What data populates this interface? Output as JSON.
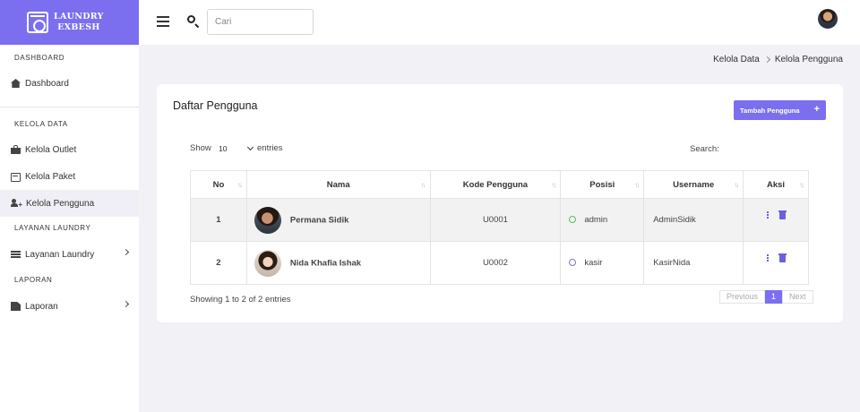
{
  "brand": {
    "line1": "LAUNDRY",
    "line2": "EXBESH"
  },
  "sidebar": {
    "sections": [
      "DASHBOARD",
      "KELOLA DATA",
      "LAYANAN LAUNDRY",
      "LAPORAN"
    ],
    "items": [
      {
        "label": "Dashboard",
        "icon": "home-icon"
      },
      {
        "label": "Kelola Outlet",
        "icon": "shopping-bag-icon"
      },
      {
        "label": "Kelola Paket",
        "icon": "card-icon"
      },
      {
        "label": "Kelola Pengguna",
        "icon": "user-plus-icon",
        "active": true
      },
      {
        "label": "Layanan Laundry",
        "icon": "list-icon"
      },
      {
        "label": "Laporan",
        "icon": "file-icon"
      }
    ]
  },
  "topbar": {
    "search_placeholder": "Cari"
  },
  "breadcrumb": [
    "Kelola Data",
    "Kelola Pengguna"
  ],
  "card": {
    "title": "Daftar Pengguna",
    "add_button": "Tambah Pengguna",
    "show_label": "Show",
    "length_value": "10",
    "entries_label": "entries",
    "search_label": "Search:"
  },
  "table": {
    "headers": [
      "No",
      "Nama",
      "Kode Pengguna",
      "Posisi",
      "Username",
      "Aksi"
    ],
    "rows": [
      {
        "no": "1",
        "nama": "Permana Sidik",
        "kode": "U0001",
        "posisi": "admin",
        "username": "AdminSidik"
      },
      {
        "no": "2",
        "nama": "Nida Khafia Ishak",
        "kode": "U0002",
        "posisi": "kasir",
        "username": "KasirNida"
      }
    ]
  },
  "footer": {
    "info": "Showing 1 to 2 of 2 entries",
    "previous": "Previous",
    "page": "1",
    "next": "Next"
  },
  "colors": {
    "accent": "#7b6ff0",
    "admin_status": "#5ac15a",
    "kasir_status": "#7b6ff0"
  }
}
